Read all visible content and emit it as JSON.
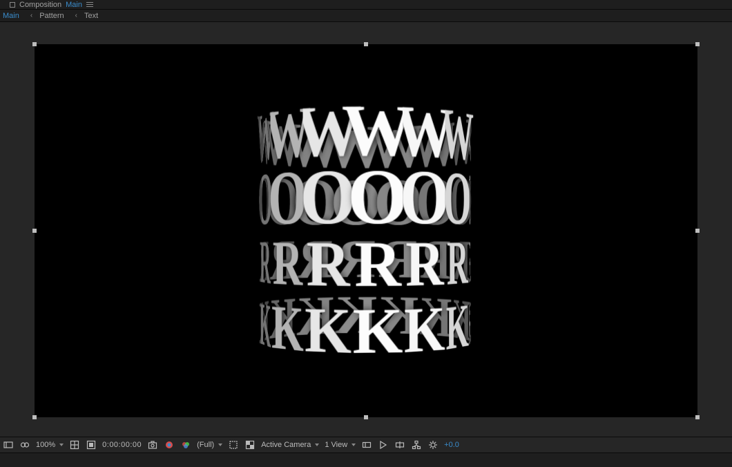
{
  "panel": {
    "title_label": "Composition",
    "comp_name": "Main"
  },
  "breadcrumb": {
    "items": [
      "Main",
      "Pattern",
      "Text"
    ]
  },
  "rings": {
    "letters": [
      "W",
      "O",
      "R",
      "K"
    ],
    "slab_count": 14,
    "radius_px": 150
  },
  "footer": {
    "magnification": "100%",
    "timecode": "0:00:00:00",
    "resolution": "(Full)",
    "camera": "Active Camera",
    "views": "1 View",
    "exposure": "+0.0"
  },
  "icons": {
    "lock": "lock-icon",
    "menu": "panel-menu-icon"
  }
}
